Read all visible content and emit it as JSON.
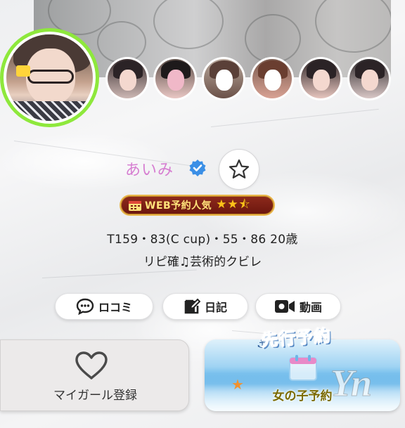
{
  "profile": {
    "name": "あいみ",
    "verified": true,
    "favorite_icon": "star-outline-icon",
    "rank_badge": {
      "label": "WEB予約人気",
      "stars_filled": 2.5,
      "stars_total": 3,
      "stars_text": "★★⯪",
      "icon": "calendar-icon"
    },
    "stats": "T159・83(C cup)・55・86 20歳",
    "catchphrase": "リピ確♫芸術的クビレ"
  },
  "thumbnails": [
    {
      "name": "thumbnail-1"
    },
    {
      "name": "thumbnail-2"
    },
    {
      "name": "thumbnail-3"
    },
    {
      "name": "thumbnail-4"
    },
    {
      "name": "thumbnail-5"
    },
    {
      "name": "thumbnail-6"
    }
  ],
  "actions": {
    "reviews": {
      "label": "ロコミ",
      "icon": "chat-bubble-icon"
    },
    "diary": {
      "label": "日記",
      "icon": "edit-note-icon"
    },
    "video": {
      "label": "動画",
      "icon": "video-camera-icon"
    }
  },
  "mygirl": {
    "label": "マイガール登録",
    "icon": "heart-outline-icon"
  },
  "advance_booking": {
    "title": "先行予約",
    "subtitle": "女の子予約"
  },
  "colors": {
    "name": "#d67ed1",
    "avatar_ring": "#8ee83c",
    "verified": "#3b8fe6",
    "badge_bg": "#7a1d12",
    "badge_border": "#e9b64a"
  }
}
